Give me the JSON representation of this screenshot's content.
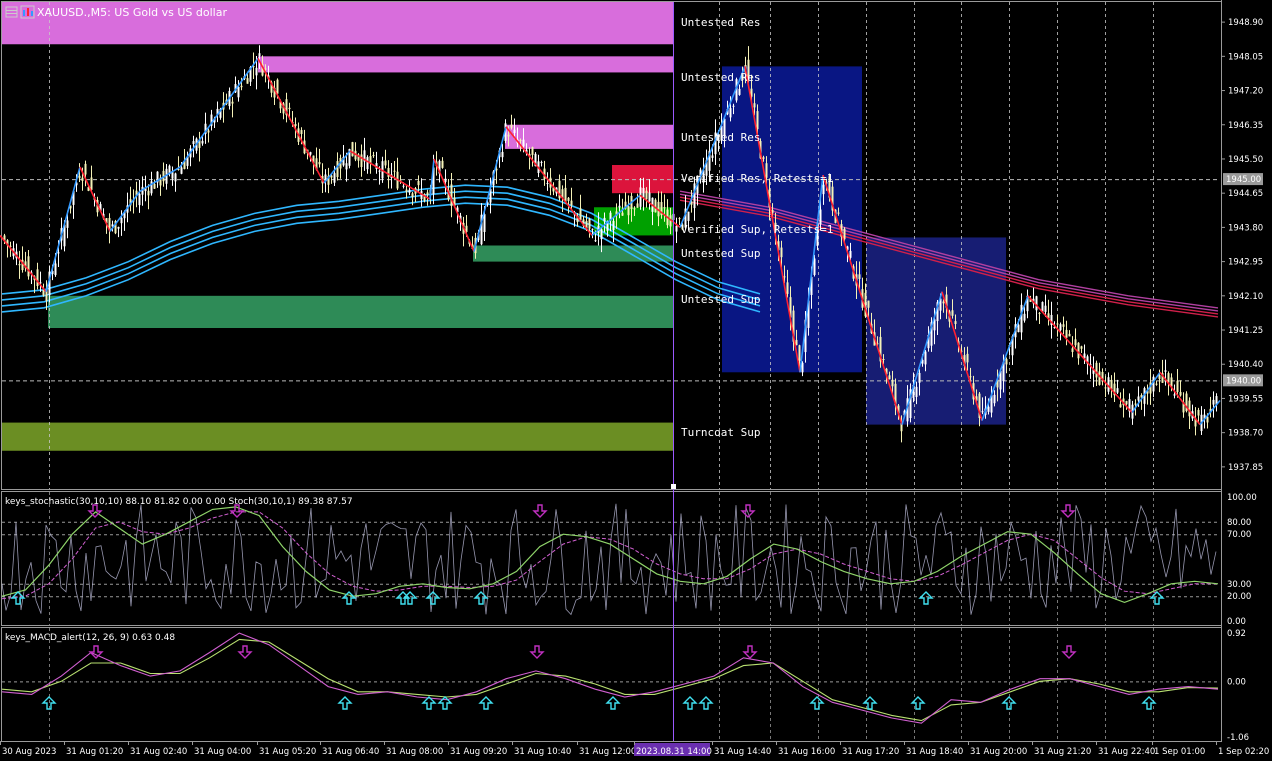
{
  "window": {
    "title": "XAUUSD.,M5:  US Gold vs US dollar"
  },
  "colors": {
    "background": "#000000",
    "bull_candle": "#ffffff",
    "bear_candle": "#f5f2b8",
    "zigzag_up": "#3399ff",
    "zigzag_down": "#ff2030",
    "ma_fast": "#2fb7ff",
    "ma_slow": "#d0204a",
    "res_zone": "#d86ddc",
    "res_verified": "#dc143c",
    "sup_zone": "#2e8b57",
    "sup_verified": "#00a000",
    "turncoat_zone": "#6b8e23",
    "box_blue": "#0a1a9a",
    "stoch_main": "#8fd46a",
    "stoch_signal": "#d05fd0",
    "stoch_raw": "#c8c8e8",
    "macd_main": "#d05fd0",
    "macd_signal": "#b8e070",
    "arrow_up": "#40e0f0",
    "arrow_down": "#c030c0",
    "highlight_time": "#6a2fb0"
  },
  "zone_labels": [
    "Untested Res",
    "Untested Res",
    "Untested Res",
    "Verified Res, Retests=1",
    "Verified Sup, Retests=1",
    "Untested Sup",
    "Untested Sup",
    "Turncoat Sup"
  ],
  "chart_data": [
    {
      "type": "line",
      "title": "XAUUSD.,M5:  US Gold vs US dollar",
      "ylim": [
        1937.3,
        1949.4
      ],
      "price_ticks": [
        "1948.90",
        "1948.05",
        "1947.20",
        "1946.35",
        "1945.50",
        "1944.65",
        "1943.80",
        "1942.95",
        "1942.10",
        "1941.25",
        "1940.40",
        "1939.55",
        "1938.70",
        "1937.85"
      ],
      "price_tags": [
        "1945.00",
        "1940.00"
      ],
      "time_labels": [
        "30 Aug 2023",
        "31 Aug 01:20",
        "31 Aug 02:40",
        "31 Aug 04:00",
        "31 Aug 05:20",
        "31 Aug 06:40",
        "31 Aug 08:00",
        "31 Aug 09:20",
        "31 Aug 10:40",
        "31 Aug 12:00",
        "2023.08.31 14:00",
        "31 Aug 14:40",
        "31 Aug 16:00",
        "31 Aug 17:20",
        "31 Aug 18:40",
        "31 Aug 20:00",
        "31 Aug 21:20",
        "31 Aug 22:40",
        "1 Sep 01:00",
        "1 Sep 02:20"
      ],
      "zigzag_pivots": [
        [
          0,
          1943.6
        ],
        [
          46,
          1942.2
        ],
        [
          80,
          1945.3
        ],
        [
          110,
          1943.7
        ],
        [
          140,
          1944.7
        ],
        [
          180,
          1945.3
        ],
        [
          258,
          1948.0
        ],
        [
          324,
          1944.9
        ],
        [
          350,
          1945.7
        ],
        [
          430,
          1944.5
        ],
        [
          434,
          1945.5
        ],
        [
          474,
          1943.2
        ],
        [
          506,
          1946.3
        ],
        [
          592,
          1943.6
        ],
        [
          640,
          1944.6
        ],
        [
          680,
          1943.8
        ],
        [
          745,
          1947.8
        ],
        [
          800,
          1940.2
        ],
        [
          823,
          1945.1
        ],
        [
          902,
          1938.9
        ],
        [
          942,
          1942.2
        ],
        [
          982,
          1939.0
        ],
        [
          1028,
          1942.1
        ],
        [
          1132,
          1939.2
        ],
        [
          1160,
          1940.2
        ],
        [
          1200,
          1938.9
        ],
        [
          1220,
          1939.5
        ]
      ],
      "series": [
        {
          "values_note": "ma_fast_band",
          "values": [
            1941.9,
            1942.0,
            1942.3,
            1942.7,
            1943.2,
            1943.6,
            1943.9,
            1944.1,
            1944.2,
            1944.35,
            1944.5,
            1944.6,
            1944.55,
            1944.3,
            1943.9,
            1943.3,
            1942.7,
            1942.2,
            1941.9
          ]
        },
        {
          "values_note": "ma_slow_band",
          "values": [
            1944.6,
            1944.2,
            1943.6,
            1943.0,
            1942.4,
            1942.0,
            1941.7
          ]
        }
      ],
      "zones": [
        {
          "kind": "res",
          "y": [
            1948.35,
            1949.55
          ],
          "x0": 2
        },
        {
          "kind": "res",
          "y": [
            1947.65,
            1948.05
          ],
          "x0": 258
        },
        {
          "kind": "res",
          "y": [
            1945.75,
            1946.35
          ],
          "x0": 505
        },
        {
          "kind": "res_verified",
          "y": [
            1944.65,
            1945.35
          ],
          "x0": 612
        },
        {
          "kind": "sup_verified",
          "y": [
            1943.6,
            1944.3
          ],
          "x0": 594
        },
        {
          "kind": "sup",
          "y": [
            1942.95,
            1943.35
          ],
          "x0": 473
        },
        {
          "kind": "sup",
          "y": [
            1941.3,
            1942.1
          ],
          "x0": 48
        },
        {
          "kind": "turncoat",
          "y": [
            1938.25,
            1938.95
          ],
          "x0": 2
        }
      ]
    },
    {
      "type": "line",
      "title": "keys_stochastic(30,10,10) 88.10 81.82 0.00 0.00  Stoch(30,10,1) 89.38 87.57",
      "ylim": [
        0,
        100
      ],
      "ticks": [
        "100.00",
        "80.00",
        "70.00",
        "30.00",
        "20.00",
        "0.00"
      ],
      "series": [
        {
          "name": "main",
          "values": [
            20,
            25,
            45,
            70,
            88,
            75,
            62,
            70,
            80,
            90,
            92,
            85,
            60,
            40,
            25,
            20,
            22,
            28,
            30,
            27,
            26,
            30,
            40,
            60,
            70,
            68,
            62,
            50,
            38,
            32,
            30,
            36,
            50,
            62,
            58,
            48,
            40,
            34,
            30,
            32,
            40,
            52,
            62,
            72,
            70,
            55,
            38,
            22,
            15,
            22,
            30,
            32,
            30
          ]
        },
        {
          "name": "signal",
          "values": [
            18,
            20,
            30,
            50,
            75,
            80,
            72,
            70,
            75,
            83,
            88,
            88,
            75,
            55,
            38,
            28,
            24,
            25,
            28,
            28,
            27,
            28,
            33,
            48,
            62,
            68,
            66,
            58,
            46,
            38,
            34,
            34,
            42,
            54,
            58,
            54,
            46,
            40,
            34,
            32,
            36,
            45,
            55,
            65,
            70,
            65,
            50,
            35,
            24,
            22,
            26,
            30,
            30
          ]
        }
      ]
    },
    {
      "type": "line",
      "title": "keys_MACD_alert(12, 26, 9) 0.63 0.48",
      "ylim": [
        -1.12,
        0.98
      ],
      "ticks": [
        "0.92",
        "0.00",
        "-1.06"
      ],
      "series": [
        {
          "name": "main",
          "values": [
            -0.2,
            -0.25,
            0.1,
            0.55,
            0.3,
            0.1,
            0.2,
            0.55,
            0.92,
            0.7,
            0.3,
            -0.1,
            -0.25,
            -0.2,
            -0.3,
            -0.35,
            -0.2,
            0.05,
            0.2,
            0.05,
            -0.15,
            -0.3,
            -0.2,
            -0.05,
            0.1,
            0.45,
            0.35,
            -0.1,
            -0.4,
            -0.55,
            -0.7,
            -0.8,
            -0.35,
            -0.4,
            -0.15,
            0.05,
            0.05,
            -0.1,
            -0.25,
            -0.15,
            -0.1,
            -0.15
          ]
        },
        {
          "name": "signal",
          "values": [
            -0.15,
            -0.2,
            0.0,
            0.35,
            0.35,
            0.15,
            0.15,
            0.45,
            0.8,
            0.75,
            0.4,
            0.05,
            -0.2,
            -0.2,
            -0.25,
            -0.3,
            -0.25,
            -0.05,
            0.15,
            0.1,
            -0.05,
            -0.25,
            -0.25,
            -0.1,
            0.05,
            0.3,
            0.35,
            0.0,
            -0.35,
            -0.5,
            -0.65,
            -0.75,
            -0.45,
            -0.4,
            -0.2,
            0.0,
            0.05,
            -0.05,
            -0.2,
            -0.2,
            -0.12,
            -0.13
          ]
        }
      ]
    }
  ],
  "stoch_arrows_down": [
    95,
    237,
    540,
    748,
    1068
  ],
  "stoch_arrows_up": [
    18,
    349,
    403,
    410,
    433,
    481,
    926,
    1157
  ],
  "macd_arrows_down": [
    96,
    245,
    537,
    750,
    1069
  ],
  "macd_arrows_up": [
    49,
    345,
    429,
    445,
    486,
    613,
    690,
    706,
    817,
    870,
    918,
    1009,
    1149
  ]
}
